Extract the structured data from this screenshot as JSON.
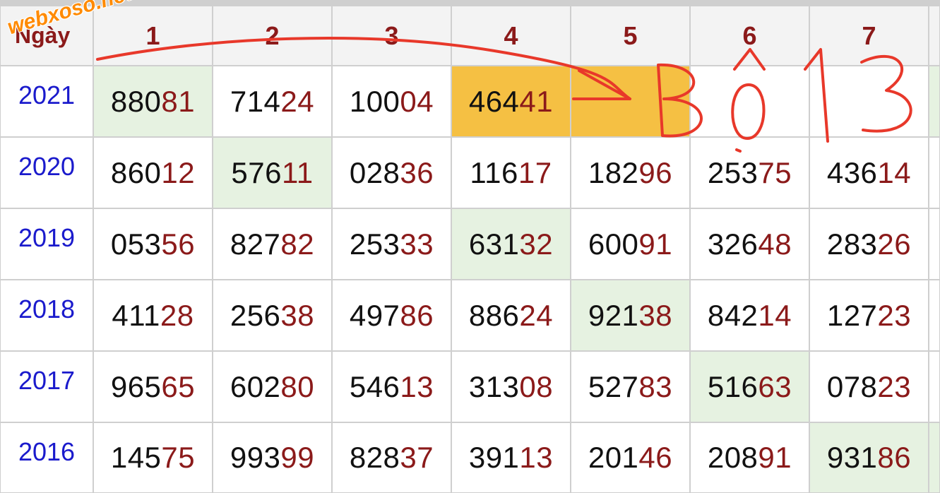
{
  "watermark": "webxoso.net",
  "header": {
    "corner": "Ngày",
    "columns": [
      "1",
      "2",
      "3",
      "4",
      "5",
      "6",
      "7"
    ]
  },
  "rows": [
    {
      "year": "2021",
      "cells": [
        {
          "prefix": "880",
          "tail": "81",
          "hl": "green"
        },
        {
          "prefix": "714",
          "tail": "24",
          "hl": ""
        },
        {
          "prefix": "100",
          "tail": "04",
          "hl": ""
        },
        {
          "prefix": "464",
          "tail": "41",
          "hl": "orange"
        },
        {
          "prefix": "",
          "tail": "",
          "hl": "orange"
        },
        {
          "prefix": "",
          "tail": "",
          "hl": ""
        },
        {
          "prefix": "",
          "tail": "",
          "hl": ""
        }
      ]
    },
    {
      "year": "2020",
      "cells": [
        {
          "prefix": "860",
          "tail": "12",
          "hl": ""
        },
        {
          "prefix": "576",
          "tail": "11",
          "hl": "green"
        },
        {
          "prefix": "028",
          "tail": "36",
          "hl": ""
        },
        {
          "prefix": "116",
          "tail": "17",
          "hl": ""
        },
        {
          "prefix": "182",
          "tail": "96",
          "hl": ""
        },
        {
          "prefix": "253",
          "tail": "75",
          "hl": ""
        },
        {
          "prefix": "436",
          "tail": "14",
          "hl": ""
        }
      ]
    },
    {
      "year": "2019",
      "cells": [
        {
          "prefix": "053",
          "tail": "56",
          "hl": ""
        },
        {
          "prefix": "827",
          "tail": "82",
          "hl": ""
        },
        {
          "prefix": "253",
          "tail": "33",
          "hl": ""
        },
        {
          "prefix": "631",
          "tail": "32",
          "hl": "green"
        },
        {
          "prefix": "600",
          "tail": "91",
          "hl": ""
        },
        {
          "prefix": "326",
          "tail": "48",
          "hl": ""
        },
        {
          "prefix": "283",
          "tail": "26",
          "hl": ""
        }
      ]
    },
    {
      "year": "2018",
      "cells": [
        {
          "prefix": "411",
          "tail": "28",
          "hl": ""
        },
        {
          "prefix": "256",
          "tail": "38",
          "hl": ""
        },
        {
          "prefix": "497",
          "tail": "86",
          "hl": ""
        },
        {
          "prefix": "886",
          "tail": "24",
          "hl": ""
        },
        {
          "prefix": "921",
          "tail": "38",
          "hl": "green"
        },
        {
          "prefix": "842",
          "tail": "14",
          "hl": ""
        },
        {
          "prefix": "127",
          "tail": "23",
          "hl": ""
        }
      ]
    },
    {
      "year": "2017",
      "cells": [
        {
          "prefix": "965",
          "tail": "65",
          "hl": ""
        },
        {
          "prefix": "602",
          "tail": "80",
          "hl": ""
        },
        {
          "prefix": "546",
          "tail": "13",
          "hl": ""
        },
        {
          "prefix": "313",
          "tail": "08",
          "hl": ""
        },
        {
          "prefix": "527",
          "tail": "83",
          "hl": ""
        },
        {
          "prefix": "516",
          "tail": "63",
          "hl": "green"
        },
        {
          "prefix": "078",
          "tail": "23",
          "hl": ""
        }
      ]
    },
    {
      "year": "2016",
      "cells": [
        {
          "prefix": "145",
          "tail": "75",
          "hl": ""
        },
        {
          "prefix": "993",
          "tail": "99",
          "hl": ""
        },
        {
          "prefix": "828",
          "tail": "37",
          "hl": ""
        },
        {
          "prefix": "391",
          "tail": "13",
          "hl": ""
        },
        {
          "prefix": "201",
          "tail": "46",
          "hl": ""
        },
        {
          "prefix": "208",
          "tail": "91",
          "hl": ""
        },
        {
          "prefix": "931",
          "tail": "86",
          "hl": "green"
        }
      ]
    }
  ],
  "annotation": {
    "text": "Bộ 13",
    "color": "#e8382a"
  },
  "colors": {
    "tail": "#8b1a1a",
    "year": "#1a1acc",
    "header": "#8b1a1a",
    "highlight_green": "#e6f2e1",
    "highlight_orange": "#f5c043",
    "grid": "#cfcfcf"
  }
}
